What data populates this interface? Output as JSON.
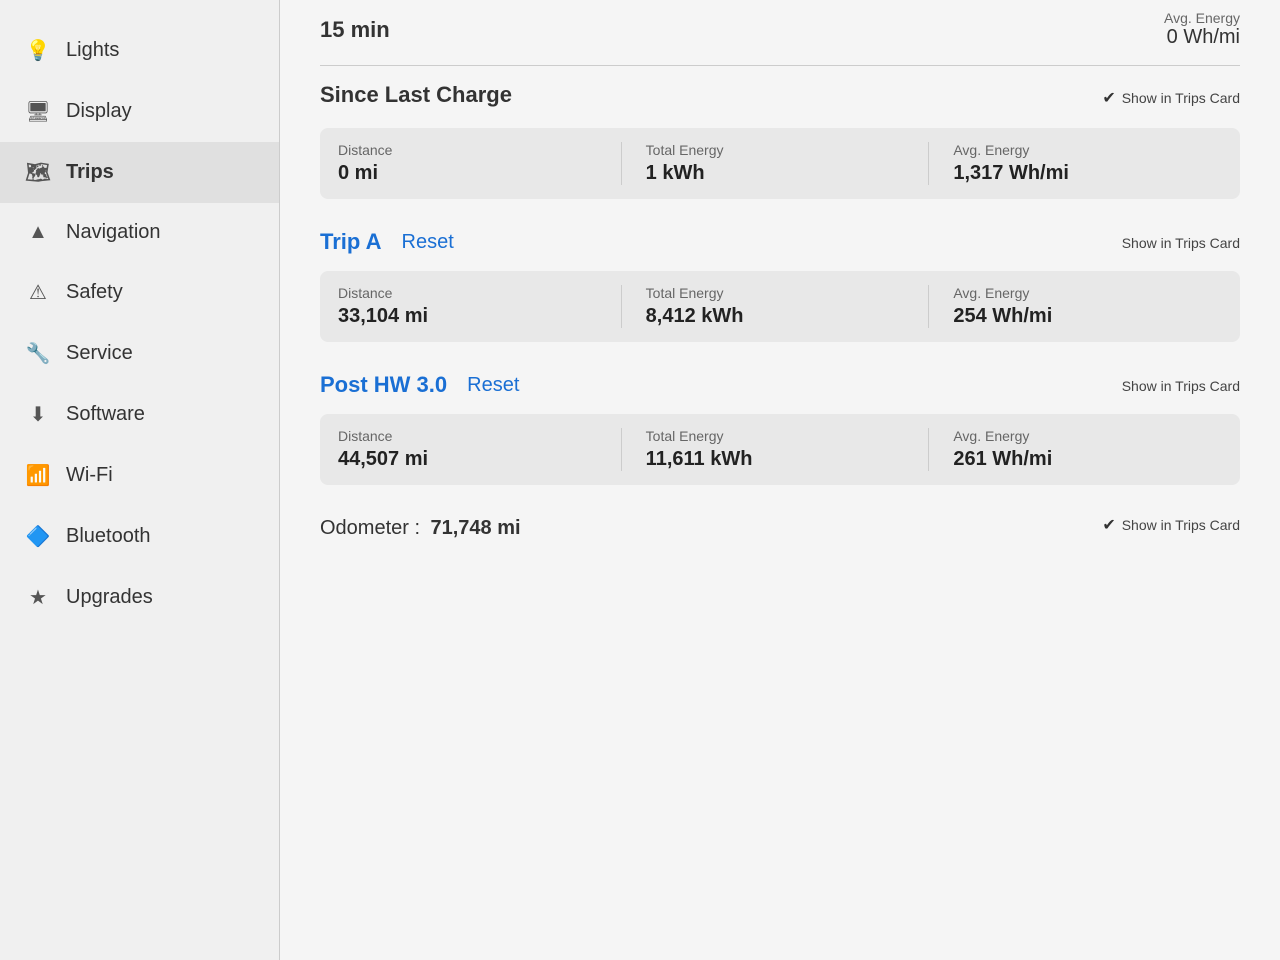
{
  "sidebar": {
    "items": [
      {
        "id": "lights",
        "label": "Lights",
        "icon": "💡"
      },
      {
        "id": "display",
        "label": "Display",
        "icon": "🖥"
      },
      {
        "id": "trips",
        "label": "Trips",
        "icon": "🗺",
        "active": true
      },
      {
        "id": "navigation",
        "label": "Navigation",
        "icon": "▲"
      },
      {
        "id": "safety",
        "label": "Safety",
        "icon": "⚠"
      },
      {
        "id": "service",
        "label": "Service",
        "icon": "🔧"
      },
      {
        "id": "software",
        "label": "Software",
        "icon": "⬇"
      },
      {
        "id": "wifi",
        "label": "Wi-Fi",
        "icon": "📶"
      },
      {
        "id": "bluetooth",
        "label": "Bluetooth",
        "icon": "🔷"
      },
      {
        "id": "upgrades",
        "label": "Upgrades",
        "icon": "★"
      }
    ]
  },
  "top": {
    "time_label": "15 min",
    "avg_energy_label": "Avg. Energy",
    "avg_energy_value": "0 Wh/mi"
  },
  "since_last_charge": {
    "title": "Since Last Charge",
    "show_in_trips": "Show in Trips Card",
    "checked": true,
    "distance_label": "Distance",
    "distance_value": "0 mi",
    "total_energy_label": "Total Energy",
    "total_energy_value": "1 kWh",
    "avg_energy_label": "Avg. Energy",
    "avg_energy_value": "1,317 Wh/mi"
  },
  "trip_a": {
    "title": "Trip A",
    "reset_label": "Reset",
    "show_in_trips": "Show in Trips Card",
    "checked": false,
    "distance_label": "Distance",
    "distance_value": "33,104 mi",
    "total_energy_label": "Total Energy",
    "total_energy_value": "8,412 kWh",
    "avg_energy_label": "Avg. Energy",
    "avg_energy_value": "254 Wh/mi"
  },
  "post_hw": {
    "title": "Post HW 3.0",
    "reset_label": "Reset",
    "show_in_trips": "Show in Trips Card",
    "checked": false,
    "distance_label": "Distance",
    "distance_value": "44,507 mi",
    "total_energy_label": "Total Energy",
    "total_energy_value": "11,611 kWh",
    "avg_energy_label": "Avg. Energy",
    "avg_energy_value": "261 Wh/mi"
  },
  "odometer": {
    "label": "Odometer :",
    "value": "71,748 mi",
    "show_in_trips": "Show in Trips Card",
    "checked": true
  }
}
